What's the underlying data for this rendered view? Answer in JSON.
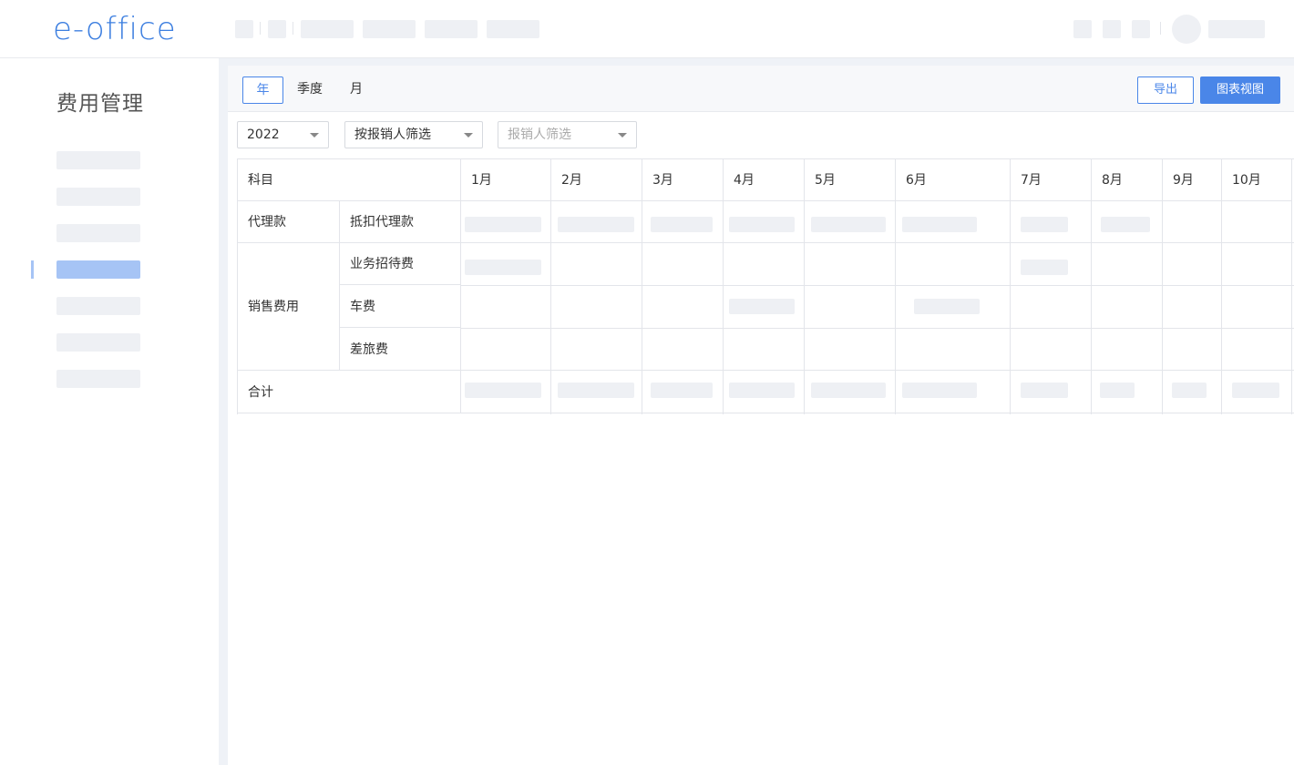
{
  "app": {
    "logo": "e-office"
  },
  "sidebar": {
    "title": "费用管理"
  },
  "tabs": [
    {
      "label": "年",
      "active": true
    },
    {
      "label": "季度",
      "active": false
    },
    {
      "label": "月",
      "active": false
    }
  ],
  "actions": {
    "export_label": "导出",
    "chart_view_label": "图表视图"
  },
  "filters": {
    "year": {
      "value": "2022"
    },
    "filter_by": {
      "value": "按报销人筛选"
    },
    "reimburser": {
      "placeholder": "报销人筛选"
    }
  },
  "table": {
    "header_subject": "科目",
    "months": [
      "1月",
      "2月",
      "3月",
      "4月",
      "5月",
      "6月",
      "7月",
      "8月",
      "9月",
      "10月"
    ],
    "rows": [
      {
        "category": "代理款",
        "items": [
          "抵扣代理款"
        ]
      },
      {
        "category": "销售费用",
        "items": [
          "业务招待费",
          "车费",
          "差旅费"
        ]
      }
    ],
    "total_label": "合计"
  },
  "colors": {
    "accent": "#4a86e8",
    "placeholder_block": "#eef0f4",
    "sidebar_active": "#a6c4f5"
  }
}
